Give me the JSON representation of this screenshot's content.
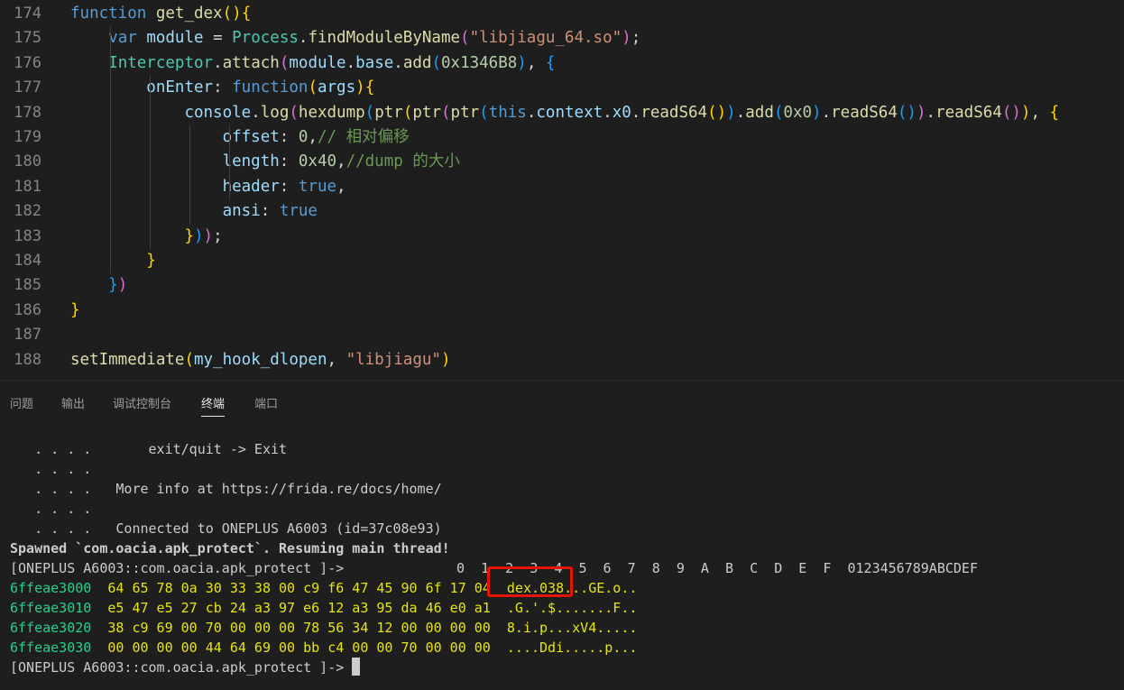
{
  "editor": {
    "lines": [
      {
        "num": "174",
        "tokens": [
          [
            "kw",
            "function"
          ],
          [
            "pl",
            " "
          ],
          [
            "fn",
            "get_dex"
          ],
          [
            "b1",
            "()"
          ],
          [
            "b1",
            "{"
          ]
        ]
      },
      {
        "num": "175",
        "tokens": [
          [
            "pl",
            "    "
          ],
          [
            "kw",
            "var"
          ],
          [
            "pl",
            " "
          ],
          [
            "vr",
            "module"
          ],
          [
            "pl",
            " = "
          ],
          [
            "ty",
            "Process"
          ],
          [
            "pl",
            "."
          ],
          [
            "fn",
            "findModuleByName"
          ],
          [
            "b2",
            "("
          ],
          [
            "st",
            "\"libjiagu_64.so\""
          ],
          [
            "b2",
            ")"
          ],
          [
            "pl",
            ";"
          ]
        ]
      },
      {
        "num": "176",
        "tokens": [
          [
            "pl",
            "    "
          ],
          [
            "ty",
            "Interceptor"
          ],
          [
            "pl",
            "."
          ],
          [
            "fn",
            "attach"
          ],
          [
            "b2",
            "("
          ],
          [
            "vr",
            "module"
          ],
          [
            "pl",
            "."
          ],
          [
            "vr",
            "base"
          ],
          [
            "pl",
            "."
          ],
          [
            "fn",
            "add"
          ],
          [
            "b3",
            "("
          ],
          [
            "nm",
            "0x1346B8"
          ],
          [
            "b3",
            ")"
          ],
          [
            "pl",
            ", "
          ],
          [
            "b3",
            "{"
          ]
        ]
      },
      {
        "num": "177",
        "tokens": [
          [
            "pl",
            "        "
          ],
          [
            "vr",
            "onEnter"
          ],
          [
            "pl",
            ": "
          ],
          [
            "kw",
            "function"
          ],
          [
            "b1",
            "("
          ],
          [
            "vr",
            "args"
          ],
          [
            "b1",
            ")"
          ],
          [
            "b1",
            "{"
          ]
        ]
      },
      {
        "num": "178",
        "tokens": [
          [
            "pl",
            "            "
          ],
          [
            "vr",
            "console"
          ],
          [
            "pl",
            "."
          ],
          [
            "fn",
            "log"
          ],
          [
            "b2",
            "("
          ],
          [
            "fn",
            "hexdump"
          ],
          [
            "b3",
            "("
          ],
          [
            "fn",
            "ptr"
          ],
          [
            "b1",
            "("
          ],
          [
            "fn",
            "ptr"
          ],
          [
            "b2",
            "("
          ],
          [
            "fn",
            "ptr"
          ],
          [
            "b3",
            "("
          ],
          [
            "kw",
            "this"
          ],
          [
            "pl",
            "."
          ],
          [
            "vr",
            "context"
          ],
          [
            "pl",
            "."
          ],
          [
            "vr",
            "x0"
          ],
          [
            "pl",
            "."
          ],
          [
            "fn",
            "readS64"
          ],
          [
            "b1",
            "()"
          ],
          [
            "b3",
            ")"
          ],
          [
            "pl",
            "."
          ],
          [
            "fn",
            "add"
          ],
          [
            "b3",
            "("
          ],
          [
            "nm",
            "0x0"
          ],
          [
            "b3",
            ")"
          ],
          [
            "pl",
            "."
          ],
          [
            "fn",
            "readS64"
          ],
          [
            "b3",
            "()"
          ],
          [
            "b2",
            ")"
          ],
          [
            "pl",
            "."
          ],
          [
            "fn",
            "readS64"
          ],
          [
            "b2",
            "()"
          ],
          [
            "b1",
            ")"
          ],
          [
            "pl",
            ", "
          ],
          [
            "b1",
            "{"
          ]
        ]
      },
      {
        "num": "179",
        "tokens": [
          [
            "pl",
            "                "
          ],
          [
            "vr",
            "offset"
          ],
          [
            "pl",
            ": "
          ],
          [
            "nm",
            "0"
          ],
          [
            "pl",
            ","
          ],
          [
            "cm",
            "// 相对偏移"
          ]
        ]
      },
      {
        "num": "180",
        "tokens": [
          [
            "pl",
            "                "
          ],
          [
            "vr",
            "length"
          ],
          [
            "pl",
            ": "
          ],
          [
            "nm",
            "0x40"
          ],
          [
            "pl",
            ","
          ],
          [
            "cm",
            "//dump 的大小"
          ]
        ]
      },
      {
        "num": "181",
        "tokens": [
          [
            "pl",
            "                "
          ],
          [
            "vr",
            "header"
          ],
          [
            "pl",
            ": "
          ],
          [
            "kw",
            "true"
          ],
          [
            "pl",
            ","
          ]
        ]
      },
      {
        "num": "182",
        "tokens": [
          [
            "pl",
            "                "
          ],
          [
            "vr",
            "ansi"
          ],
          [
            "pl",
            ": "
          ],
          [
            "kw",
            "true"
          ]
        ]
      },
      {
        "num": "183",
        "tokens": [
          [
            "pl",
            "            "
          ],
          [
            "b1",
            "}"
          ],
          [
            "b3",
            ")"
          ],
          [
            "b2",
            ")"
          ],
          [
            "pl",
            ";"
          ]
        ]
      },
      {
        "num": "184",
        "tokens": [
          [
            "pl",
            "        "
          ],
          [
            "b1",
            "}"
          ]
        ]
      },
      {
        "num": "185",
        "tokens": [
          [
            "pl",
            "    "
          ],
          [
            "b3",
            "}"
          ],
          [
            "b2",
            ")"
          ]
        ]
      },
      {
        "num": "186",
        "tokens": [
          [
            "b1",
            "}"
          ]
        ]
      },
      {
        "num": "187",
        "tokens": []
      },
      {
        "num": "188",
        "tokens": [
          [
            "fn",
            "setImmediate"
          ],
          [
            "b1",
            "("
          ],
          [
            "vr",
            "my_hook_dlopen"
          ],
          [
            "pl",
            ", "
          ],
          [
            "st",
            "\"libjiagu\""
          ],
          [
            "b1",
            ")"
          ]
        ]
      }
    ]
  },
  "panel": {
    "tabs": [
      {
        "label": "问题",
        "active": false
      },
      {
        "label": "输出",
        "active": false
      },
      {
        "label": "调试控制台",
        "active": false
      },
      {
        "label": "终端",
        "active": true
      },
      {
        "label": "端口",
        "active": false
      }
    ]
  },
  "terminal": {
    "banner": [
      "   . . . .       exit/quit -> Exit",
      "   . . . .",
      "   . . . .   More info at https://frida.re/docs/home/",
      "   . . . .",
      "   . . . .   Connected to ONEPLUS A6003 (id=37c08e93)"
    ],
    "spawned": "Spawned `com.oacia.apk_protect`. Resuming main thread!",
    "prompt": "[ONEPLUS A6003::com.oacia.apk_protect ]->",
    "hex_header": "0  1  2  3  4  5  6  7  8  9  A  B  C  D  E  F  0123456789ABCDEF",
    "hex_rows": [
      {
        "addr": "6ffeae3000",
        "bytes": "64 65 78 0a 30 33 38 00 c9 f6 47 45 90 6f 17 04",
        "ascii": "dex.038...GE.o.."
      },
      {
        "addr": "6ffeae3010",
        "bytes": "e5 47 e5 27 cb 24 a3 97 e6 12 a3 95 da 46 e0 a1",
        "ascii": ".G.'.$.......F.."
      },
      {
        "addr": "6ffeae3020",
        "bytes": "38 c9 69 00 70 00 00 00 78 56 34 12 00 00 00 00",
        "ascii": "8.i.p...xV4....."
      },
      {
        "addr": "6ffeae3030",
        "bytes": "00 00 00 00 44 64 69 00 bb c4 00 00 70 00 00 00",
        "ascii": "....Ddi.....p..."
      }
    ],
    "final_prompt": "[ONEPLUS A6003::com.oacia.apk_protect ]->"
  },
  "colors": {
    "background": "#1e1e1e",
    "address": "#23d18b",
    "hex_bytes": "#e5e510",
    "highlight_box": "#e51400"
  }
}
